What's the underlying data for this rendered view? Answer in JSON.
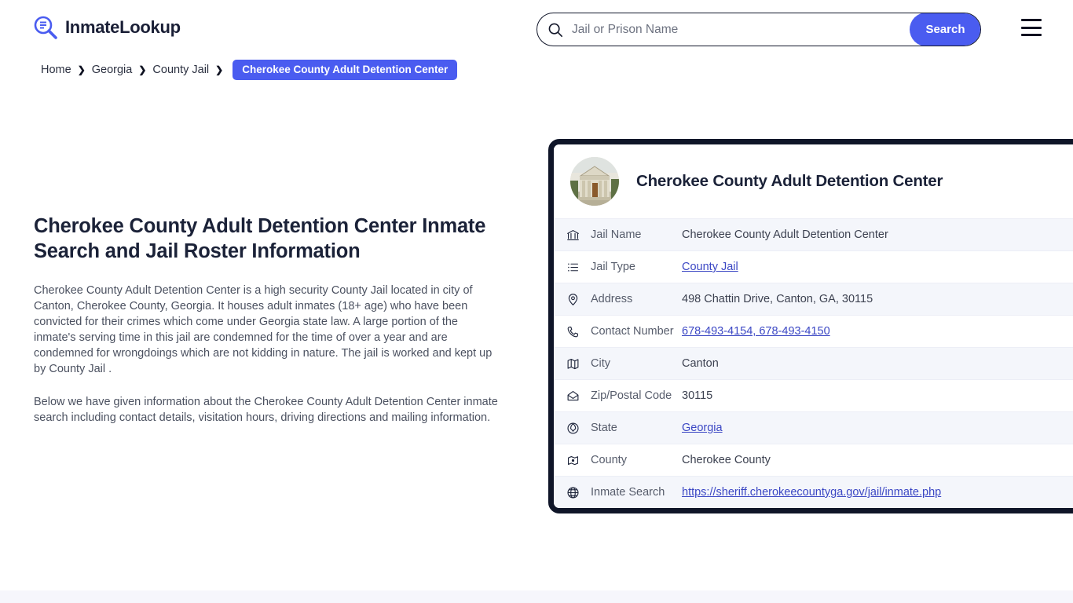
{
  "header": {
    "brand_name": "InmateLookup",
    "brand_icon": "magnifier-list-logo-icon",
    "search": {
      "placeholder": "Jail or Prison Name",
      "value": "",
      "icon": "search-icon",
      "button_label": "Search"
    },
    "menu_icon": "hamburger-menu-icon"
  },
  "breadcrumb": {
    "items": [
      {
        "label": "Home",
        "current": false
      },
      {
        "label": "Georgia",
        "current": false
      },
      {
        "label": "County Jail",
        "current": false
      },
      {
        "label": "Cherokee County Adult Detention Center",
        "current": true
      }
    ],
    "separator": "❯"
  },
  "main": {
    "title": "Cherokee County Adult Detention Center Inmate Search and Jail Roster Information",
    "paragraphs": [
      "Cherokee County Adult Detention Center is a high security County Jail located in city of Canton, Cherokee County, Georgia. It houses adult inmates (18+ age) who have been convicted for their crimes which come under Georgia state law. A large portion of the inmate's serving time in this jail are condemned for the time of over a year and are condemned for wrongdoings which are not kidding in nature. The jail is worked and kept up by County Jail .",
      "Below we have given information about the Cherokee County Adult Detention Center inmate search including contact details, visitation hours, driving directions and mailing information."
    ]
  },
  "card": {
    "avatar_icon": "courthouse-building-photo",
    "title": "Cherokee County Adult Detention Center",
    "rows": [
      {
        "icon": "bank-building-icon",
        "label": "Jail Name",
        "value": "Cherokee County Adult Detention Center",
        "link": false
      },
      {
        "icon": "list-icon",
        "label": "Jail Type",
        "value": "County Jail",
        "link": true
      },
      {
        "icon": "map-pin-icon",
        "label": "Address",
        "value": "498 Chattin Drive, Canton, GA, 30115",
        "link": false
      },
      {
        "icon": "phone-icon",
        "label": "Contact Number",
        "value": "678-493-4154, 678-493-4150",
        "link": true
      },
      {
        "icon": "map-icon",
        "label": "City",
        "value": "Canton",
        "link": false
      },
      {
        "icon": "envelope-icon",
        "label": "Zip/Postal Code",
        "value": "30115",
        "link": false
      },
      {
        "icon": "state-globe-icon",
        "label": "State",
        "value": "Georgia",
        "link": true
      },
      {
        "icon": "county-map-icon",
        "label": "County",
        "value": "Cherokee County",
        "link": false
      },
      {
        "icon": "globe-icon",
        "label": "Inmate Search",
        "value": "https://sheriff.cherokeecountyga.gov/jail/inmate.php",
        "link": true
      }
    ]
  },
  "colors": {
    "accent": "#4a5cf0",
    "dark": "#0f1528",
    "link": "#3b47c4",
    "row_alt": "#f4f6fb",
    "bottom_band": "#f6f6fc"
  }
}
